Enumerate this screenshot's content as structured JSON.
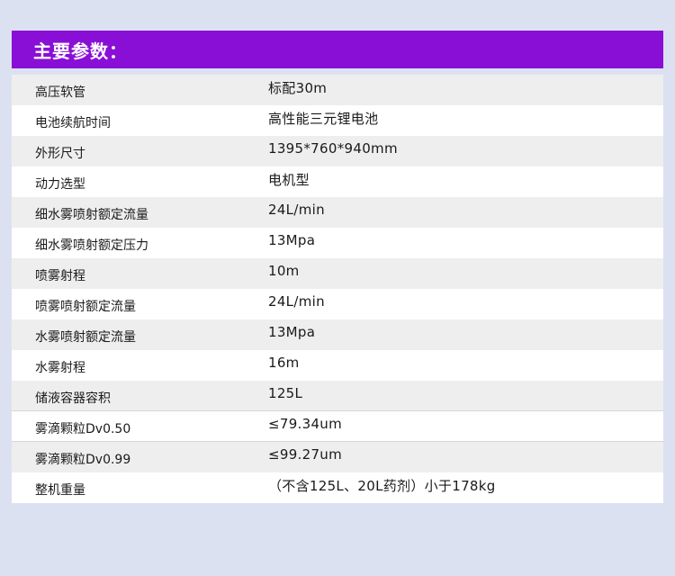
{
  "header": {
    "title": "主要参数："
  },
  "params": [
    {
      "label": "高压软管",
      "value": "标配30m"
    },
    {
      "label": "电池续航时间",
      "value": "高性能三元锂电池"
    },
    {
      "label": "外形尺寸",
      "value": "1395*760*940mm"
    },
    {
      "label": "动力选型",
      "value": "电机型"
    },
    {
      "label": "细水雾喷射额定流量",
      "value": "24L/min"
    },
    {
      "label": "细水雾喷射额定压力",
      "value": "13Mpa"
    },
    {
      "label": "喷雾射程",
      "value": "10m"
    },
    {
      "label": "喷雾喷射额定流量",
      "value": "24L/min"
    },
    {
      "label": "水雾喷射额定流量",
      "value": "13Mpa"
    },
    {
      "label": "水雾射程",
      "value": "16m"
    },
    {
      "label": "储液容器容积",
      "value": "125L"
    },
    {
      "label": "雾滴颗粒Dv0.50",
      "value": "≤79.34um"
    },
    {
      "label": "雾滴颗粒Dv0.99",
      "value": "≤99.27um"
    },
    {
      "label": "整机重量",
      "value": "（不含125L、20L药剂）小于178kg"
    }
  ]
}
